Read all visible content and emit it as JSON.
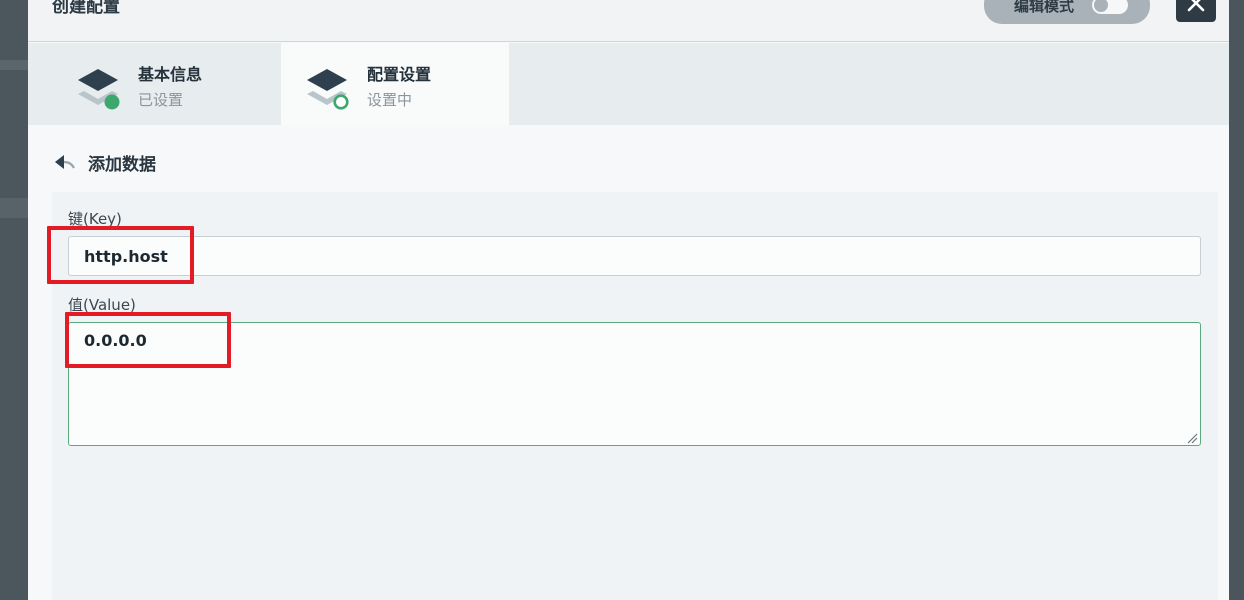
{
  "modal": {
    "title": "创建配置",
    "edit_mode_label": "编辑模式",
    "close_icon": "close-x-icon"
  },
  "steps": [
    {
      "title": "基本信息",
      "status": "已设置",
      "icon": "layers-icon",
      "status_color": "#3da86e"
    },
    {
      "title": "配置设置",
      "status": "设置中",
      "icon": "layers-icon",
      "status_color": "#3da86e"
    }
  ],
  "back": {
    "label": "添加数据",
    "icon": "back-arrow-icon"
  },
  "form": {
    "key_label": "键(Key)",
    "key_value": "http.host",
    "value_label": "值(Value)",
    "value_value": "0.0.0.0"
  },
  "colors": {
    "accent_green": "#3da86e",
    "annotation_red": "#e21b24",
    "dark": "#2f3b44"
  }
}
